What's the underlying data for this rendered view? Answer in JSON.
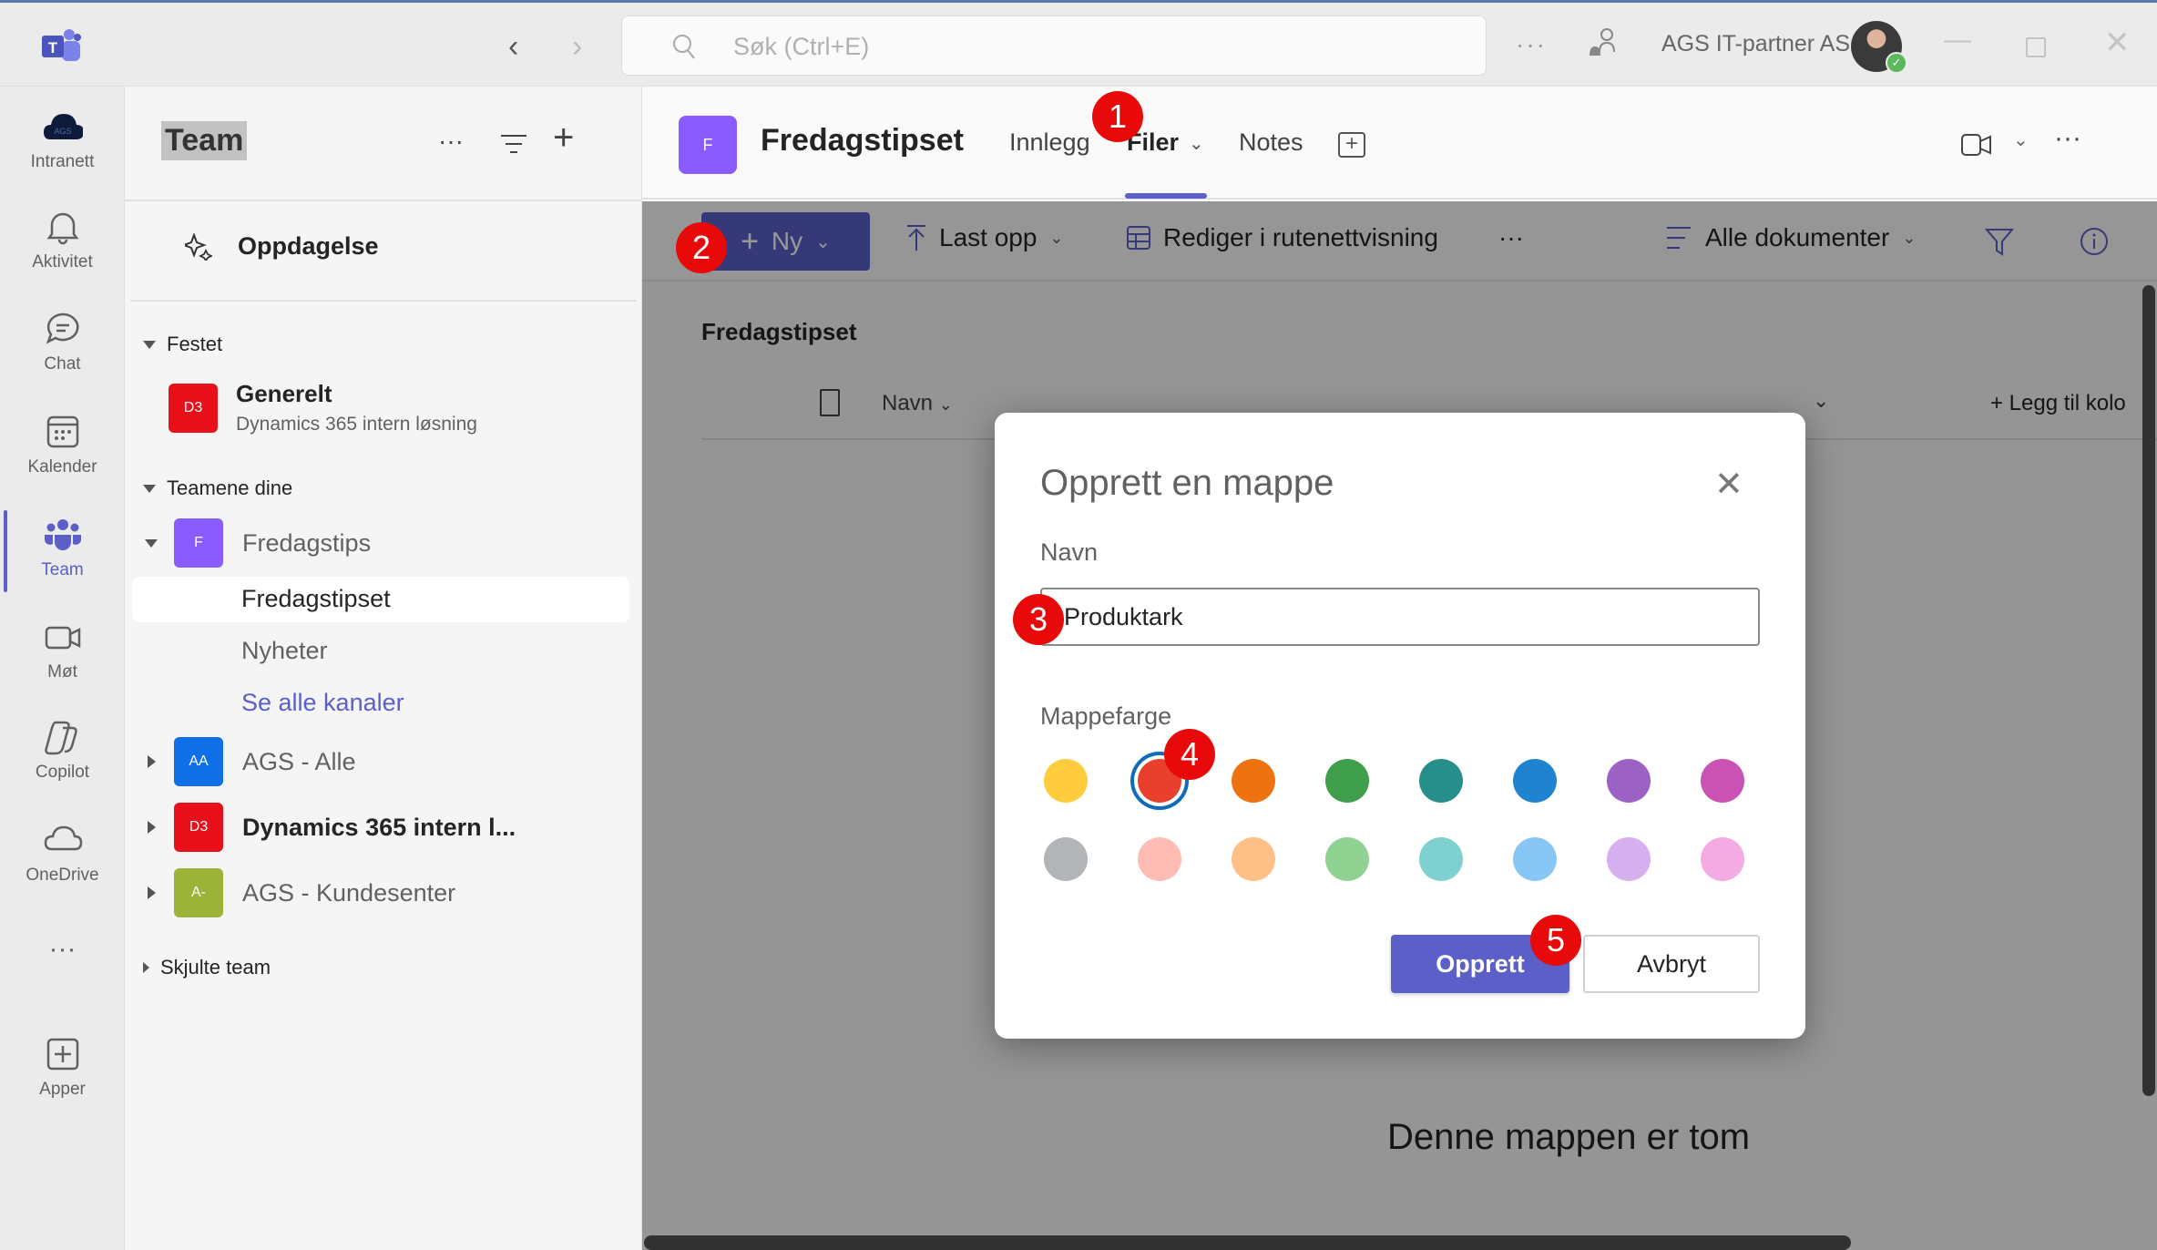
{
  "titlebar": {
    "search_placeholder": "Søk (Ctrl+E)",
    "more_label": "···",
    "org_name": "AGS IT-partner AS",
    "nav_back": "‹",
    "nav_forward": "›",
    "min_label": "—",
    "close_label": "✕",
    "status_check": "✓"
  },
  "rail": {
    "items": [
      {
        "label": "Intranett",
        "icon": "ags-cloud-icon"
      },
      {
        "label": "Aktivitet",
        "icon": "bell-icon"
      },
      {
        "label": "Chat",
        "icon": "chat-icon"
      },
      {
        "label": "Kalender",
        "icon": "calendar-icon"
      },
      {
        "label": "Team",
        "icon": "teams-icon",
        "active": true
      },
      {
        "label": "Møt",
        "icon": "video-icon"
      },
      {
        "label": "Copilot",
        "icon": "copilot-icon"
      },
      {
        "label": "OneDrive",
        "icon": "cloud-icon"
      },
      {
        "label": "···",
        "icon": "more-icon"
      },
      {
        "label": "Apper",
        "icon": "add-app-icon"
      }
    ],
    "intranet_logo_text": "AGS"
  },
  "team_panel": {
    "title": "Team",
    "more": "···",
    "add": "+",
    "discover_label": "Oppdagelse",
    "pinned_header": "Festet",
    "pinned": {
      "avatar": "D3",
      "name": "Generelt",
      "sub": "Dynamics 365 intern løsning",
      "color": "#e8101a"
    },
    "your_teams_header": "Teamene dine",
    "teams": [
      {
        "avatar": "F",
        "name": "Fredagstips",
        "color": "#8a5cff",
        "expanded": true,
        "channels": [
          "Fredagstipset",
          "Nyheter"
        ],
        "see_all": "Se alle kanaler"
      },
      {
        "avatar": "AA",
        "name": "AGS - Alle",
        "color": "#0f6fe6"
      },
      {
        "avatar": "D3",
        "name": "Dynamics 365 intern l...",
        "color": "#e8101a",
        "bold": true
      },
      {
        "avatar": "A-",
        "name": "AGS - Kundesenter",
        "color": "#9bb336"
      }
    ],
    "hidden_header": "Skjulte team"
  },
  "channel": {
    "avatar": "F",
    "title": "Fredagstipset",
    "tabs": [
      {
        "label": "Innlegg"
      },
      {
        "label": "Filer",
        "active": true,
        "dropdown": "⌄"
      },
      {
        "label": "Notes"
      }
    ],
    "add_tab": "+",
    "more": "···"
  },
  "files": {
    "toolbar": {
      "new_label": "Ny",
      "upload_label": "Last opp",
      "grid_label": "Rediger i rutenettvisning",
      "more": "···",
      "view_label": "Alle dokumenter"
    },
    "library_title": "Fredagstipset",
    "columns": {
      "name": "Navn",
      "add_column": "+  Legg til kolo"
    },
    "empty_message": "Denne mappen er tom"
  },
  "dialog": {
    "title": "Opprett en mappe",
    "close": "✕",
    "name_label": "Navn",
    "name_value": "Produktark",
    "color_label": "Mappefarge",
    "colors": [
      "#ffcc3d",
      "#e8402d",
      "#ec7212",
      "#3f9e4c",
      "#268f8a",
      "#1f83d0",
      "#9b61c4",
      "#c952b3",
      "#b1b5b8",
      "#ffbcb5",
      "#ffbf87",
      "#8fd292",
      "#7ed1cf",
      "#88c7f5",
      "#d6afef",
      "#f4abe3"
    ],
    "selected_color_index": 1,
    "primary_label": "Opprett",
    "secondary_label": "Avbryt"
  },
  "steps": [
    "1",
    "2",
    "3",
    "4",
    "5"
  ]
}
